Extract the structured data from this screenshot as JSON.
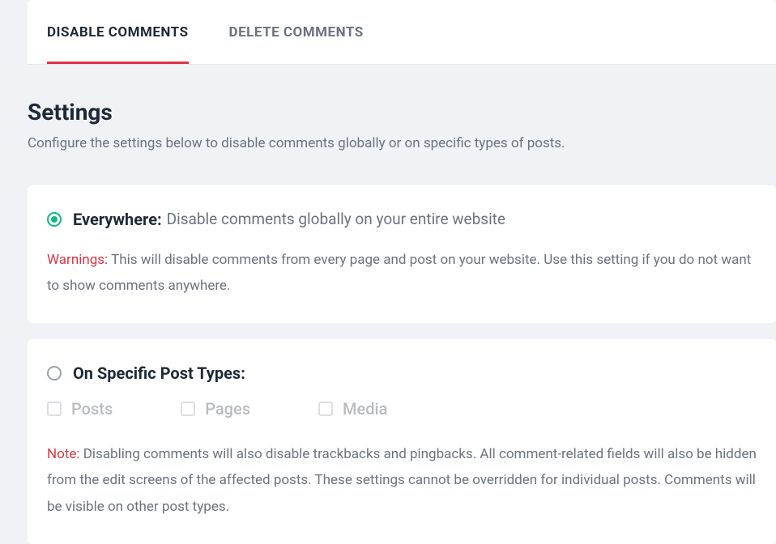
{
  "tabs": {
    "disable": "DISABLE COMMENTS",
    "delete": "DELETE COMMENTS"
  },
  "settings": {
    "title": "Settings",
    "description": "Configure the settings below to disable comments globally or on specific types of posts."
  },
  "option_everywhere": {
    "label": "Everywhere:",
    "description": "Disable comments globally on your entire website",
    "warning_label": "Warnings:",
    "warning_text": "This will disable comments from every page and post on your website. Use this setting if you do not want to show comments anywhere."
  },
  "option_specific": {
    "label": "On Specific Post Types:",
    "checkboxes": {
      "posts": "Posts",
      "pages": "Pages",
      "media": "Media"
    },
    "note_label": "Note:",
    "note_text": "Disabling comments will also disable trackbacks and pingbacks. All comment-related fields will also be hidden from the edit screens of the affected posts. These settings cannot be overridden for individual posts. Comments will be visible on other post types."
  }
}
